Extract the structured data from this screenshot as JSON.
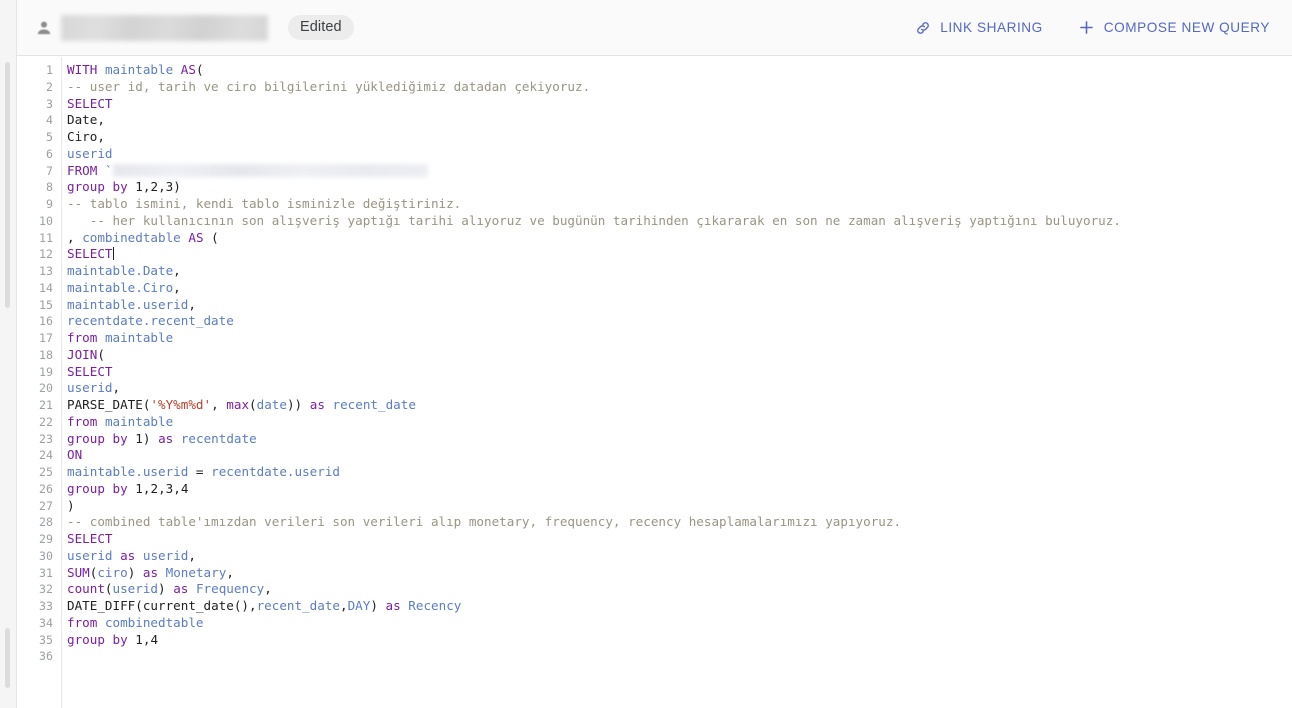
{
  "window": {
    "app": "BigQuery SQL Query Editor"
  },
  "header": {
    "avatar_icon": "person-icon",
    "title_redacted": "",
    "edited_badge": "Edited",
    "actions": [
      {
        "icon": "link-icon",
        "label": "LINK SHARING"
      },
      {
        "icon": "plus-icon",
        "label": "COMPOSE NEW QUERY"
      }
    ],
    "accent_color": "#5468c4",
    "background": "#fafafa"
  },
  "editor": {
    "language": "sql",
    "cursor_line": 12,
    "cursor_column": 7,
    "total_lines": 36,
    "gutter_color": "#9aa0a6",
    "lines": [
      {
        "n": "1",
        "text": "WITH maintable AS("
      },
      {
        "n": "2",
        "text": "-- user id, tarih ve ciro bilgilerini yüklediğimiz datadan çekiyoruz."
      },
      {
        "n": "3",
        "text": "SELECT"
      },
      {
        "n": "4",
        "text": "Date,"
      },
      {
        "n": "5",
        "text": "Ciro,"
      },
      {
        "n": "6",
        "text": "userid"
      },
      {
        "n": "7",
        "text": "FROM `                    `"
      },
      {
        "n": "8",
        "text": "group by 1,2,3)"
      },
      {
        "n": "9",
        "text": "-- tablo ismini, kendi tablo isminizle değiştiriniz."
      },
      {
        "n": "10",
        "text": "   -- her kullanıcının son alışveriş yaptığı tarihi alıyoruz ve bugünün tarihinden çıkararak en son ne zaman alışveriş yaptığını buluyoruz."
      },
      {
        "n": "11",
        "text": ", combinedtable AS ("
      },
      {
        "n": "12",
        "text": "SELECT"
      },
      {
        "n": "13",
        "text": "maintable.Date,"
      },
      {
        "n": "14",
        "text": "maintable.Ciro,"
      },
      {
        "n": "15",
        "text": "maintable.userid,"
      },
      {
        "n": "16",
        "text": "recentdate.recent_date"
      },
      {
        "n": "17",
        "text": "from maintable"
      },
      {
        "n": "18",
        "text": "JOIN("
      },
      {
        "n": "19",
        "text": "SELECT"
      },
      {
        "n": "20",
        "text": "userid,"
      },
      {
        "n": "21",
        "text": "PARSE_DATE('%Y%m%d', max(date)) as recent_date"
      },
      {
        "n": "22",
        "text": "from maintable"
      },
      {
        "n": "23",
        "text": "group by 1) as recentdate"
      },
      {
        "n": "24",
        "text": "ON"
      },
      {
        "n": "25",
        "text": "maintable.userid = recentdate.userid"
      },
      {
        "n": "26",
        "text": "group by 1,2,3,4"
      },
      {
        "n": "27",
        "text": ")"
      },
      {
        "n": "28",
        "text": "-- combined table'ımızdan verileri son verileri alıp monetary, frequency, recency hesaplamalarımızı yapıyoruz."
      },
      {
        "n": "29",
        "text": "SELECT"
      },
      {
        "n": "30",
        "text": "userid as userid,"
      },
      {
        "n": "31",
        "text": "SUM(ciro) as Monetary,"
      },
      {
        "n": "32",
        "text": "count(userid) as Frequency,"
      },
      {
        "n": "33",
        "text": "DATE_DIFF(current_date(),recent_date,DAY) as Recency"
      },
      {
        "n": "34",
        "text": "from combinedtable"
      },
      {
        "n": "35",
        "text": "group by 1,4"
      },
      {
        "n": "36",
        "text": ""
      }
    ]
  }
}
